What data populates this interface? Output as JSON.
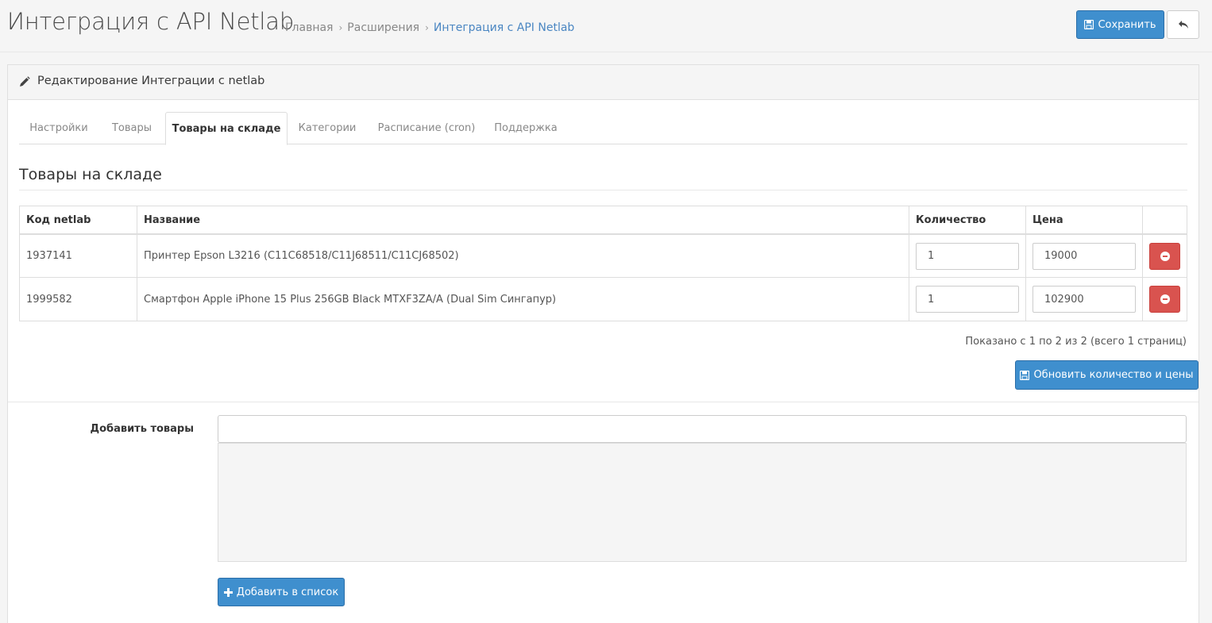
{
  "header": {
    "title": "Интеграция с API Netlab",
    "breadcrumb": [
      "Главная",
      "Расширения",
      "Интеграция с API Netlab"
    ],
    "save_label": "Сохранить"
  },
  "panel": {
    "title": "Редактирование Интеграции с netlab"
  },
  "tabs": [
    {
      "label": "Настройки",
      "active": false
    },
    {
      "label": "Товары",
      "active": false
    },
    {
      "label": "Товары на складе",
      "active": true
    },
    {
      "label": "Категории",
      "active": false
    },
    {
      "label": "Расписание (cron)",
      "active": false
    },
    {
      "label": "Поддержка",
      "active": false
    }
  ],
  "section_title": "Товары на складе",
  "table": {
    "headers": [
      "Код netlab",
      "Название",
      "Количество",
      "Цена"
    ],
    "rows": [
      {
        "code": "1937141",
        "name": "Принтер Epson L3216 (C11C68518/C11J68511/C11CJ68502)",
        "quantity": "1",
        "price": "19000"
      },
      {
        "code": "1999582",
        "name": "Смартфон Apple iPhone 15 Plus 256GB Black MTXF3ZA/A (Dual Sim Сингапур)",
        "quantity": "1",
        "price": "102900"
      }
    ]
  },
  "pagination_text": "Показано с 1 по 2 из 2 (всего 1 страниц)",
  "update_label": "Обновить количество и цены",
  "add_products": {
    "label": "Добавить товары",
    "input_value": "",
    "button_label": "Добавить в список"
  },
  "colors": {
    "primary": "#3f8fce",
    "danger": "#d9534f",
    "link": "#4a86c2"
  }
}
